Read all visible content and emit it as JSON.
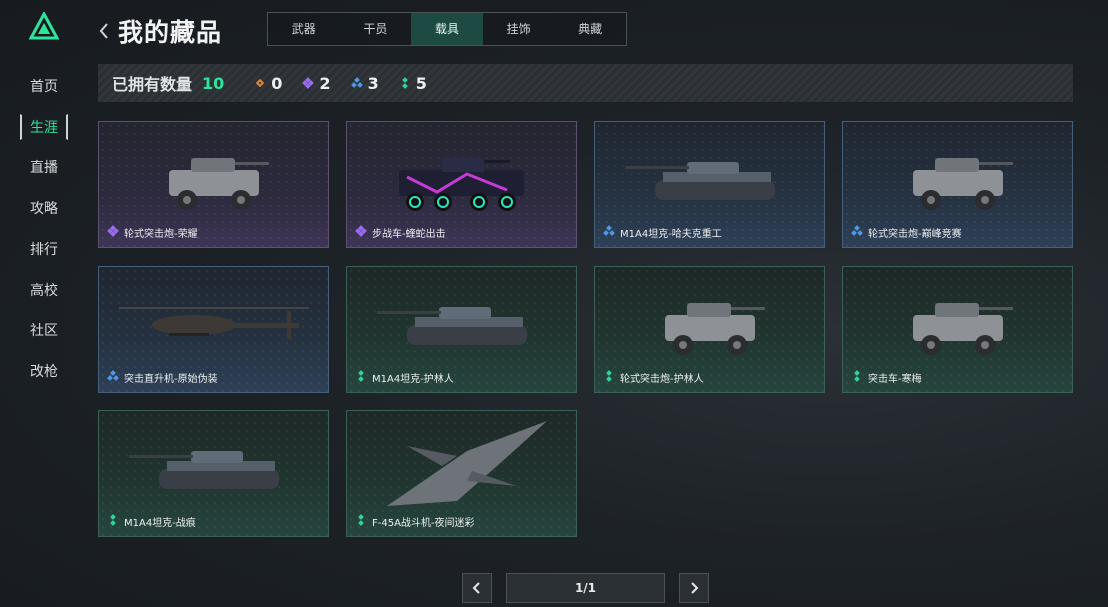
{
  "nav": {
    "items": [
      {
        "label": "首页"
      },
      {
        "label": "生涯"
      },
      {
        "label": "直播"
      },
      {
        "label": "攻略"
      },
      {
        "label": "排行"
      },
      {
        "label": "高校"
      },
      {
        "label": "社区"
      },
      {
        "label": "改枪"
      }
    ],
    "active": "生涯"
  },
  "header": {
    "title": "我的藏品",
    "tabs": [
      {
        "label": "武器"
      },
      {
        "label": "干员"
      },
      {
        "label": "载具"
      },
      {
        "label": "挂饰"
      },
      {
        "label": "典藏"
      }
    ],
    "active_tab": "载具"
  },
  "stats": {
    "owned_label": "已拥有数量",
    "owned_count": "10",
    "rarities": [
      {
        "icon": "orange-diamond-icon",
        "color": "#e0873a",
        "value": "0"
      },
      {
        "icon": "purple-diamond-icon",
        "color": "#9b6cf0",
        "value": "2"
      },
      {
        "icon": "blue-diamond-icon",
        "color": "#4f9ae8",
        "value": "3"
      },
      {
        "icon": "green-dots-icon",
        "color": "#2fd39a",
        "value": "5"
      }
    ]
  },
  "items": [
    {
      "name": "轮式突击炮-荣耀",
      "rarity": "purple",
      "art": "wheeled"
    },
    {
      "name": "步战车-蝰蛇出击",
      "rarity": "purple",
      "art": "ifv"
    },
    {
      "name": "M1A4坦克-哈夫克重工",
      "rarity": "blue",
      "art": "tank"
    },
    {
      "name": "轮式突击炮-巅峰竞赛",
      "rarity": "blue",
      "art": "wheeled"
    },
    {
      "name": "突击直升机-原始伪装",
      "rarity": "blue",
      "art": "heli"
    },
    {
      "name": "M1A4坦克-护林人",
      "rarity": "green",
      "art": "tank"
    },
    {
      "name": "轮式突击炮-护林人",
      "rarity": "green",
      "art": "wheeled"
    },
    {
      "name": "突击车-寒梅",
      "rarity": "green",
      "art": "wheeled"
    },
    {
      "name": "M1A4坦克-战痕",
      "rarity": "green",
      "art": "tank"
    },
    {
      "name": "F-45A战斗机-夜间迷彩",
      "rarity": "green",
      "art": "jet"
    }
  ],
  "pager": {
    "text": "1/1"
  },
  "colors": {
    "accent": "#2fe39a",
    "purple": "#9b6cf0",
    "blue": "#4f9ae8",
    "green": "#2fd39a"
  }
}
